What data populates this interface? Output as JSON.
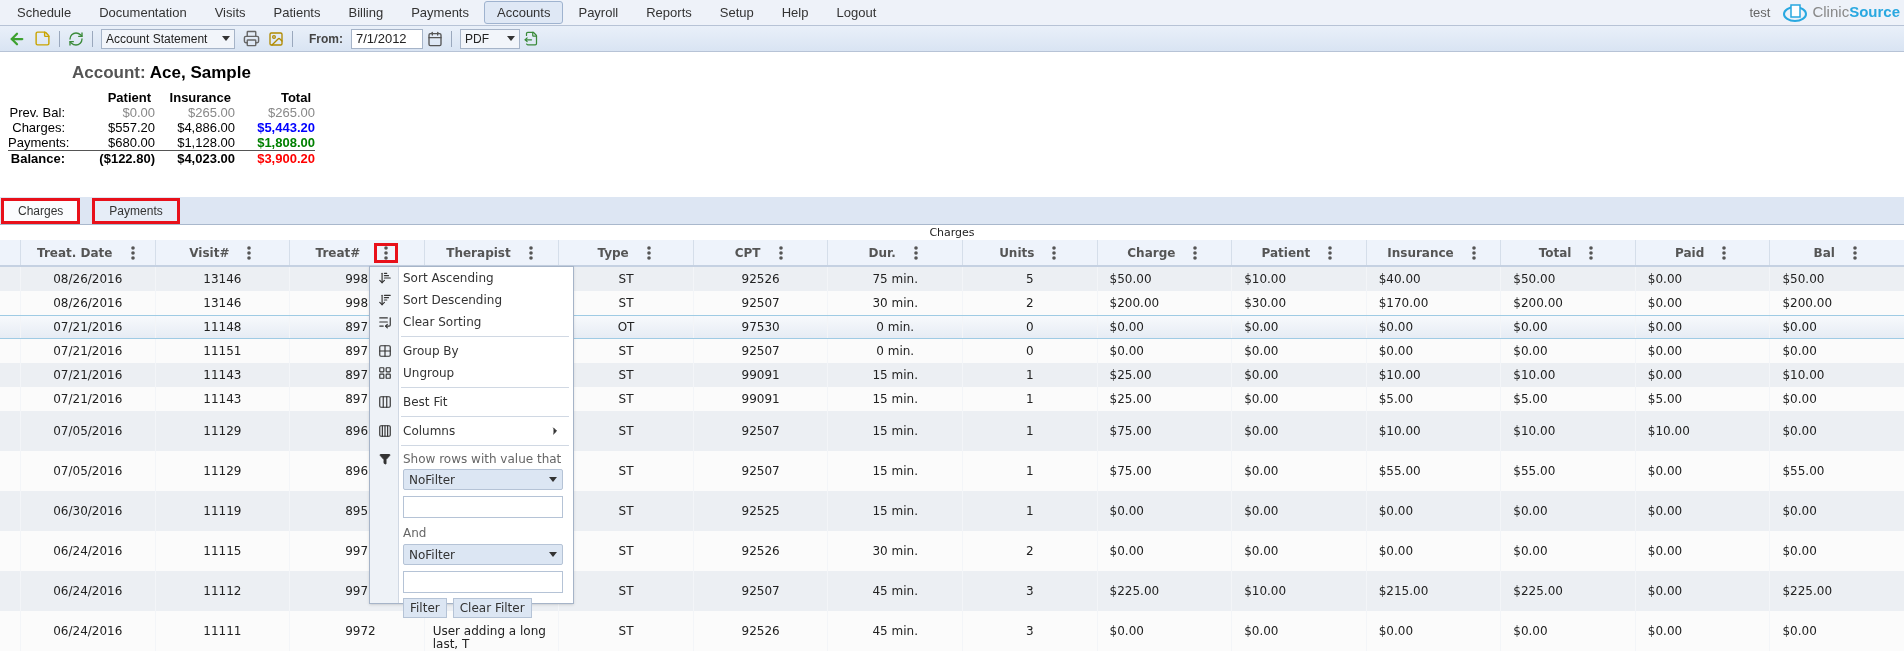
{
  "menu_bar": {
    "items": [
      {
        "label": "Schedule",
        "selected": false
      },
      {
        "label": "Documentation",
        "selected": false
      },
      {
        "label": "Visits",
        "selected": false
      },
      {
        "label": "Patients",
        "selected": false
      },
      {
        "label": "Billing",
        "selected": false
      },
      {
        "label": "Payments",
        "selected": false
      },
      {
        "label": "Accounts",
        "selected": true
      },
      {
        "label": "Payroll",
        "selected": false
      },
      {
        "label": "Reports",
        "selected": false
      },
      {
        "label": "Setup",
        "selected": false
      },
      {
        "label": "Help",
        "selected": false
      },
      {
        "label": "Logout",
        "selected": false
      }
    ],
    "user": "test",
    "logo": {
      "part_1": "Clinic",
      "part_2": "Source"
    }
  },
  "toolbar": {
    "report_select": "Account Statement",
    "from_label": "From:",
    "from_date": "7/1/2012",
    "format_select": "PDF"
  },
  "account": {
    "label": "Account:",
    "name": "Ace, Sample",
    "columns": [
      "Patient",
      "Insurance",
      "Total"
    ],
    "rows": [
      {
        "label": "Prev. Bal:",
        "kind": "muted",
        "patient": "$0.00",
        "insurance": "$265.00",
        "total": "$265.00",
        "color": "#888888"
      },
      {
        "label": "Charges:",
        "kind": "line",
        "patient": "$557.20",
        "insurance": "$4,886.00",
        "total": "$5,443.20",
        "color": "#0000ff"
      },
      {
        "label": "Payments:",
        "kind": "line",
        "patient": "$680.00",
        "insurance": "$1,128.00",
        "total": "$1,808.00",
        "color": "#008000"
      },
      {
        "label": "Balance:",
        "kind": "total",
        "patient": "($122.80)",
        "insurance": "$4,023.00",
        "total": "$3,900.20",
        "color": "#ff0000"
      }
    ]
  },
  "tabs": [
    {
      "label": "Charges",
      "selected": true,
      "highlighted": true
    },
    {
      "label": "Payments",
      "selected": false,
      "highlighted": true
    }
  ],
  "grid": {
    "caption": "Charges",
    "columns": [
      {
        "label": "Treat. Date",
        "highlighted": false
      },
      {
        "label": "Visit#",
        "highlighted": false
      },
      {
        "label": "Treat#",
        "highlighted": true
      },
      {
        "label": "Therapist",
        "highlighted": false
      },
      {
        "label": "Type",
        "highlighted": false
      },
      {
        "label": "CPT",
        "highlighted": false
      },
      {
        "label": "Dur.",
        "highlighted": false
      },
      {
        "label": "Units",
        "highlighted": false
      },
      {
        "label": "Charge",
        "highlighted": false
      },
      {
        "label": "Patient",
        "highlighted": false
      },
      {
        "label": "Insurance",
        "highlighted": false
      },
      {
        "label": "Total",
        "highlighted": false
      },
      {
        "label": "Paid",
        "highlighted": false
      },
      {
        "label": "Bal",
        "highlighted": false
      }
    ],
    "rows": [
      {
        "selected": false,
        "cells": [
          "08/26/2016",
          "13146",
          "998",
          "",
          "ST",
          "92526",
          "75 min.",
          "5",
          "$50.00",
          "$10.00",
          "$40.00",
          "$50.00",
          "$0.00",
          "$50.00"
        ]
      },
      {
        "selected": false,
        "cells": [
          "08/26/2016",
          "13146",
          "998",
          "",
          "ST",
          "92507",
          "30 min.",
          "2",
          "$200.00",
          "$30.00",
          "$170.00",
          "$200.00",
          "$0.00",
          "$200.00"
        ]
      },
      {
        "selected": true,
        "cells": [
          "07/21/2016",
          "11148",
          "897",
          "",
          "OT",
          "97530",
          "0 min.",
          "0",
          "$0.00",
          "$0.00",
          "$0.00",
          "$0.00",
          "$0.00",
          "$0.00"
        ]
      },
      {
        "selected": false,
        "cells": [
          "07/21/2016",
          "11151",
          "897",
          "",
          "ST",
          "92507",
          "0 min.",
          "0",
          "$0.00",
          "$0.00",
          "$0.00",
          "$0.00",
          "$0.00",
          "$0.00"
        ]
      },
      {
        "selected": false,
        "cells": [
          "07/21/2016",
          "11143",
          "897",
          "",
          "ST",
          "99091",
          "15 min.",
          "1",
          "$25.00",
          "$0.00",
          "$10.00",
          "$10.00",
          "$0.00",
          "$10.00"
        ]
      },
      {
        "selected": false,
        "cells": [
          "07/21/2016",
          "11143",
          "897",
          "",
          "ST",
          "99091",
          "15 min.",
          "1",
          "$25.00",
          "$0.00",
          "$5.00",
          "$5.00",
          "$5.00",
          "$0.00"
        ]
      },
      {
        "selected": false,
        "cells": [
          "07/05/2016",
          "11129",
          "896",
          "",
          "ST",
          "92507",
          "15 min.",
          "1",
          "$75.00",
          "$0.00",
          "$10.00",
          "$10.00",
          "$10.00",
          "$0.00"
        ]
      },
      {
        "selected": false,
        "cells": [
          "07/05/2016",
          "11129",
          "896",
          "",
          "ST",
          "92507",
          "15 min.",
          "1",
          "$75.00",
          "$0.00",
          "$55.00",
          "$55.00",
          "$0.00",
          "$55.00"
        ]
      },
      {
        "selected": false,
        "cells": [
          "06/30/2016",
          "11119",
          "895",
          "",
          "ST",
          "92525",
          "15 min.",
          "1",
          "$0.00",
          "$0.00",
          "$0.00",
          "$0.00",
          "$0.00",
          "$0.00"
        ]
      },
      {
        "selected": false,
        "cells": [
          "06/24/2016",
          "11115",
          "997",
          "",
          "ST",
          "92526",
          "30 min.",
          "2",
          "$0.00",
          "$0.00",
          "$0.00",
          "$0.00",
          "$0.00",
          "$0.00"
        ]
      },
      {
        "selected": false,
        "cells": [
          "06/24/2016",
          "11112",
          "997",
          "",
          "ST",
          "92507",
          "45 min.",
          "3",
          "$225.00",
          "$10.00",
          "$215.00",
          "$225.00",
          "$0.00",
          "$225.00"
        ]
      },
      {
        "selected": false,
        "cells": [
          "06/24/2016",
          "11111",
          "9972",
          "User adding a long last, T",
          "ST",
          "92526",
          "45 min.",
          "3",
          "$0.00",
          "$0.00",
          "$0.00",
          "$0.00",
          "$0.00",
          "$0.00"
        ]
      }
    ]
  },
  "column_menu": {
    "items": [
      {
        "label": "Sort Ascending",
        "kind": "item"
      },
      {
        "label": "Sort Descending",
        "kind": "item"
      },
      {
        "label": "Clear Sorting",
        "kind": "item"
      },
      {
        "label": "Group By",
        "kind": "item"
      },
      {
        "label": "Ungroup",
        "kind": "item"
      },
      {
        "label": "Best Fit",
        "kind": "item"
      },
      {
        "label": "Columns",
        "kind": "submenu"
      }
    ],
    "filter": {
      "prompt": "Show rows with value that",
      "condition_1": "NoFilter",
      "joiner": "And",
      "condition_2": "NoFilter",
      "buttons": [
        "Filter",
        "Clear Filter"
      ]
    }
  }
}
